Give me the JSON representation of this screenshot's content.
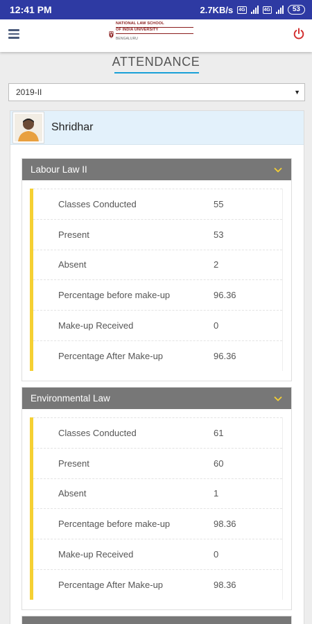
{
  "status_bar": {
    "time": "12:41 PM",
    "speed": "2.7KB/s",
    "sim1": "4G",
    "sim2": "4G",
    "battery": "53"
  },
  "app_bar": {
    "logo_line1": "NATIONAL LAW SCHOOL",
    "logo_line2": "OF INDIA UNIVERSITY",
    "logo_city": "BENGALURU",
    "menu_icon": "hamburger-menu",
    "power_icon": "power",
    "power_color": "#d32f2f"
  },
  "page": {
    "title": "ATTENDANCE",
    "accent": "#18a0d8"
  },
  "term_select": {
    "value": "2019-II"
  },
  "student": {
    "name": "Shridhar"
  },
  "subjects": [
    {
      "name": "Labour Law II",
      "rows": [
        {
          "label": "Classes Conducted",
          "value": "55"
        },
        {
          "label": "Present",
          "value": "53"
        },
        {
          "label": "Absent",
          "value": "2"
        },
        {
          "label": "Percentage before make-up",
          "value": "96.36"
        },
        {
          "label": "Make-up Received",
          "value": "0"
        },
        {
          "label": "Percentage After Make-up",
          "value": "96.36"
        }
      ]
    },
    {
      "name": "Environmental Law",
      "rows": [
        {
          "label": "Classes Conducted",
          "value": "61"
        },
        {
          "label": "Present",
          "value": "60"
        },
        {
          "label": "Absent",
          "value": "1"
        },
        {
          "label": "Percentage before make-up",
          "value": "98.36"
        },
        {
          "label": "Make-up Received",
          "value": "0"
        },
        {
          "label": "Percentage After Make-up",
          "value": "98.36"
        }
      ]
    }
  ],
  "colors": {
    "status_bar": "#2e3aa3",
    "subject_header": "#777777",
    "row_accent": "#f5d033",
    "student_bg": "#e3f1fb"
  }
}
